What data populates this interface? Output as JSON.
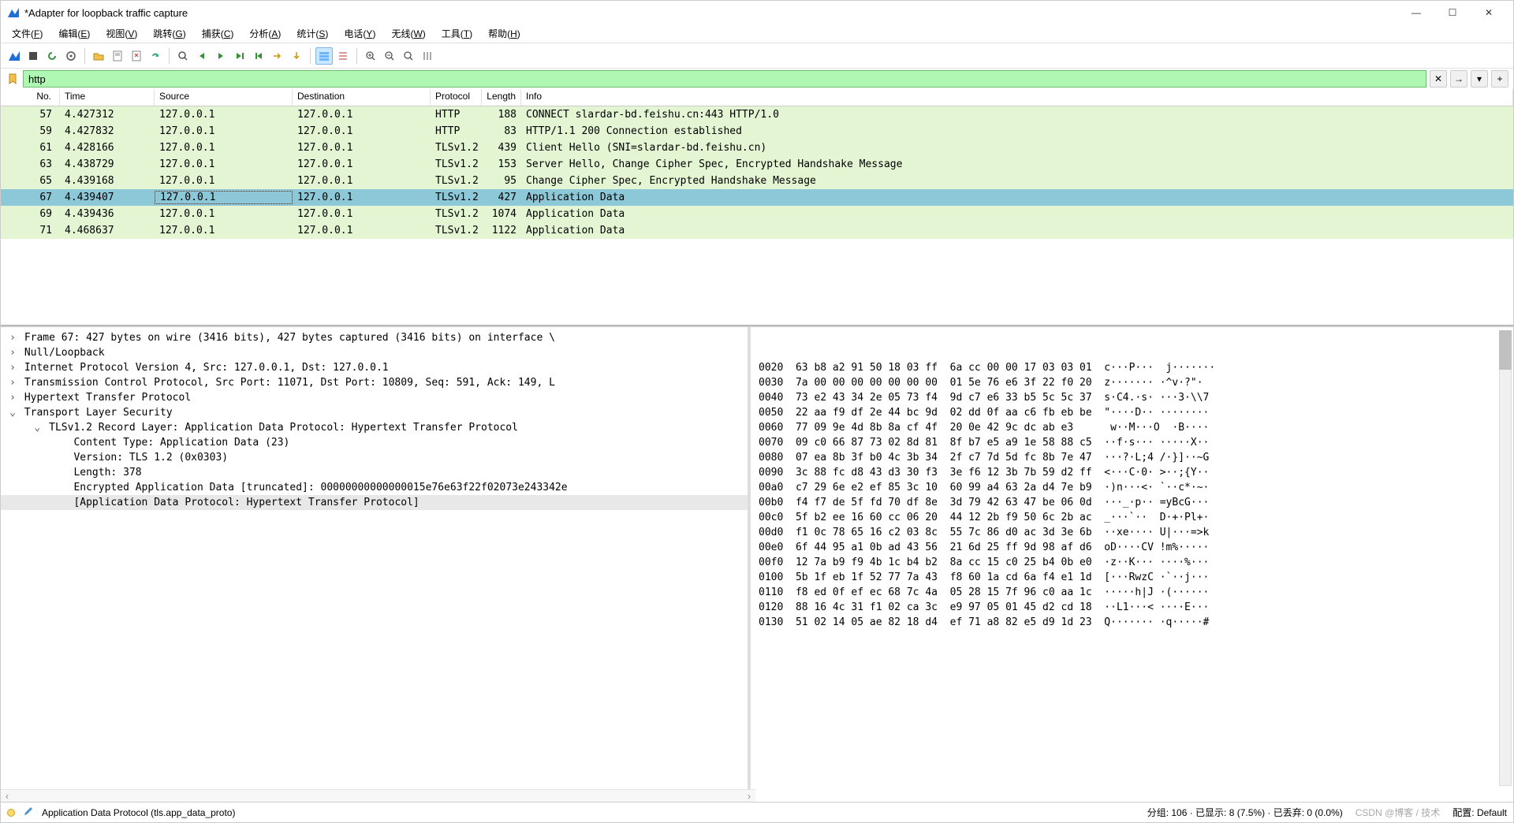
{
  "title": "*Adapter for loopback traffic capture",
  "menu": [
    {
      "label": "文件",
      "accel": "F"
    },
    {
      "label": "编辑",
      "accel": "E"
    },
    {
      "label": "视图",
      "accel": "V"
    },
    {
      "label": "跳转",
      "accel": "G"
    },
    {
      "label": "捕获",
      "accel": "C"
    },
    {
      "label": "分析",
      "accel": "A"
    },
    {
      "label": "统计",
      "accel": "S"
    },
    {
      "label": "电话",
      "accel": "Y"
    },
    {
      "label": "无线",
      "accel": "W"
    },
    {
      "label": "工具",
      "accel": "T"
    },
    {
      "label": "帮助",
      "accel": "H"
    }
  ],
  "filter": {
    "value": "http"
  },
  "columns": {
    "no": "No.",
    "time": "Time",
    "source": "Source",
    "destination": "Destination",
    "protocol": "Protocol",
    "length": "Length",
    "info": "Info"
  },
  "packets": [
    {
      "no": "57",
      "time": "4.427312",
      "src": "127.0.0.1",
      "dst": "127.0.0.1",
      "proto": "HTTP",
      "len": "188",
      "info": "CONNECT slardar-bd.feishu.cn:443 HTTP/1.0",
      "class": "http"
    },
    {
      "no": "59",
      "time": "4.427832",
      "src": "127.0.0.1",
      "dst": "127.0.0.1",
      "proto": "HTTP",
      "len": "83",
      "info": "HTTP/1.1 200 Connection established",
      "class": "http"
    },
    {
      "no": "61",
      "time": "4.428166",
      "src": "127.0.0.1",
      "dst": "127.0.0.1",
      "proto": "TLSv1.2",
      "len": "439",
      "info": "Client Hello (SNI=slardar-bd.feishu.cn)",
      "class": "http"
    },
    {
      "no": "63",
      "time": "4.438729",
      "src": "127.0.0.1",
      "dst": "127.0.0.1",
      "proto": "TLSv1.2",
      "len": "153",
      "info": "Server Hello, Change Cipher Spec, Encrypted Handshake Message",
      "class": "http"
    },
    {
      "no": "65",
      "time": "4.439168",
      "src": "127.0.0.1",
      "dst": "127.0.0.1",
      "proto": "TLSv1.2",
      "len": "95",
      "info": "Change Cipher Spec, Encrypted Handshake Message",
      "class": "http"
    },
    {
      "no": "67",
      "time": "4.439407",
      "src": "127.0.0.1",
      "dst": "127.0.0.1",
      "proto": "TLSv1.2",
      "len": "427",
      "info": "Application Data",
      "class": "http",
      "selected": true
    },
    {
      "no": "69",
      "time": "4.439436",
      "src": "127.0.0.1",
      "dst": "127.0.0.1",
      "proto": "TLSv1.2",
      "len": "1074",
      "info": "Application Data",
      "class": "http"
    },
    {
      "no": "71",
      "time": "4.468637",
      "src": "127.0.0.1",
      "dst": "127.0.0.1",
      "proto": "TLSv1.2",
      "len": "1122",
      "info": "Application Data",
      "class": "http"
    }
  ],
  "details": [
    {
      "depth": 0,
      "exp": ">",
      "text": "Frame 67: 427 bytes on wire (3416 bits), 427 bytes captured (3416 bits) on interface \\"
    },
    {
      "depth": 0,
      "exp": ">",
      "text": "Null/Loopback"
    },
    {
      "depth": 0,
      "exp": ">",
      "text": "Internet Protocol Version 4, Src: 127.0.0.1, Dst: 127.0.0.1"
    },
    {
      "depth": 0,
      "exp": ">",
      "text": "Transmission Control Protocol, Src Port: 11071, Dst Port: 10809, Seq: 591, Ack: 149, L"
    },
    {
      "depth": 0,
      "exp": ">",
      "text": "Hypertext Transfer Protocol"
    },
    {
      "depth": 0,
      "exp": "v",
      "text": "Transport Layer Security"
    },
    {
      "depth": 1,
      "exp": "v",
      "text": "TLSv1.2 Record Layer: Application Data Protocol: Hypertext Transfer Protocol"
    },
    {
      "depth": 2,
      "exp": " ",
      "text": "Content Type: Application Data (23)"
    },
    {
      "depth": 2,
      "exp": " ",
      "text": "Version: TLS 1.2 (0x0303)"
    },
    {
      "depth": 2,
      "exp": " ",
      "text": "Length: 378"
    },
    {
      "depth": 2,
      "exp": " ",
      "text": "Encrypted Application Data [truncated]: 00000000000000015e76e63f22f02073e243342e"
    },
    {
      "depth": 2,
      "exp": " ",
      "text": "[Application Data Protocol: Hypertext Transfer Protocol]",
      "highlight": true
    }
  ],
  "hex": [
    {
      "off": "0020",
      "b": "63 b8 a2 91 50 18 03 ff  6a cc 00 00 17 03 03 01",
      "a": "c···P···  j·······"
    },
    {
      "off": "0030",
      "b": "7a 00 00 00 00 00 00 00  01 5e 76 e6 3f 22 f0 20",
      "a": "z······· ·^v·?\"·"
    },
    {
      "off": "0040",
      "b": "73 e2 43 34 2e 05 73 f4  9d c7 e6 33 b5 5c 5c 37",
      "a": "s·C4.·s· ···3·\\\\7"
    },
    {
      "off": "0050",
      "b": "22 aa f9 df 2e 44 bc 9d  02 dd 0f aa c6 fb eb be",
      "a": "\"····D·· ········"
    },
    {
      "off": "0060",
      "b": "77 09 9e 4d 8b 8a cf 4f  20 0e 42 9c dc ab e3    ",
      "a": "w··M···O  ·B····"
    },
    {
      "off": "0070",
      "b": "09 c0 66 87 73 02 8d 81  8f b7 e5 a9 1e 58 88 c5",
      "a": "··f·s··· ·····X··"
    },
    {
      "off": "0080",
      "b": "07 ea 8b 3f b0 4c 3b 34  2f c7 7d 5d fc 8b 7e 47",
      "a": "···?·L;4 /·}]··~G"
    },
    {
      "off": "0090",
      "b": "3c 88 fc d8 43 d3 30 f3  3e f6 12 3b 7b 59 d2 ff",
      "a": "<···C·0· >··;{Y··"
    },
    {
      "off": "00a0",
      "b": "c7 29 6e e2 ef 85 3c 10  60 99 a4 63 2a d4 7e b9",
      "a": "·)n···<· `··c*·~·"
    },
    {
      "off": "00b0",
      "b": "f4 f7 de 5f fd 70 df 8e  3d 79 42 63 47 be 06 0d",
      "a": "···_·p·· =yBcG···"
    },
    {
      "off": "00c0",
      "b": "5f b2 ee 16 60 cc 06 20  44 12 2b f9 50 6c 2b ac",
      "a": "_···`··  D·+·Pl+·"
    },
    {
      "off": "00d0",
      "b": "f1 0c 78 65 16 c2 03 8c  55 7c 86 d0 ac 3d 3e 6b",
      "a": "··xe···· U|···=>k"
    },
    {
      "off": "00e0",
      "b": "6f 44 95 a1 0b ad 43 56  21 6d 25 ff 9d 98 af d6",
      "a": "oD····CV !m%·····"
    },
    {
      "off": "00f0",
      "b": "12 7a b9 f9 4b 1c b4 b2  8a cc 15 c0 25 b4 0b e0",
      "a": "·z··K··· ····%···"
    },
    {
      "off": "0100",
      "b": "5b 1f eb 1f 52 77 7a 43  f8 60 1a cd 6a f4 e1 1d",
      "a": "[···RwzC ·`··j···"
    },
    {
      "off": "0110",
      "b": "f8 ed 0f ef ec 68 7c 4a  05 28 15 7f 96 c0 aa 1c",
      "a": "·····h|J ·(······"
    },
    {
      "off": "0120",
      "b": "88 16 4c 31 f1 02 ca 3c  e9 97 05 01 45 d2 cd 18",
      "a": "··L1···< ····E···"
    },
    {
      "off": "0130",
      "b": "51 02 14 05 ae 82 18 d4  ef 71 a8 82 e5 d9 1d 23",
      "a": "Q······· ·q·····#"
    }
  ],
  "status": {
    "field": "Application Data Protocol (tls.app_data_proto)",
    "packets": "分组: 106 · 已显示: 8 (7.5%) · 已丢弃: 0 (0.0%)",
    "profile": "配置: Default",
    "watermark": "CSDN @博客 / 技术"
  }
}
